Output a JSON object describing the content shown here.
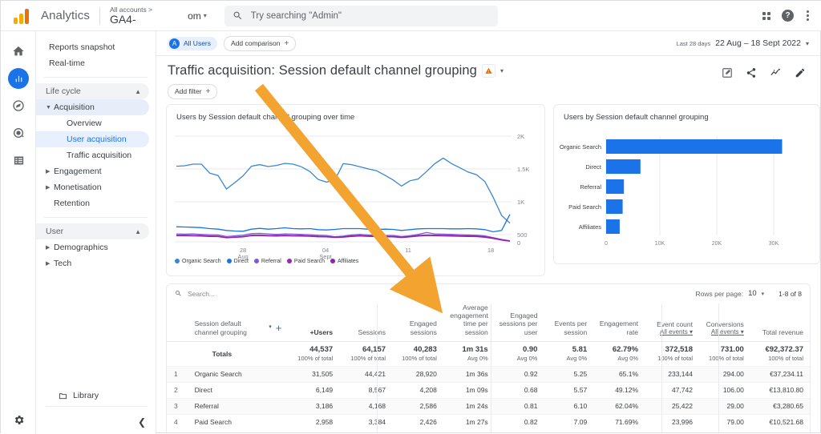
{
  "header": {
    "brand": "Analytics",
    "account_label": "All accounts >",
    "property_name": "GA4-",
    "property_tail": "om",
    "search_placeholder": "Try searching \"Admin\"",
    "logo_icon": "analytics-bars-icon",
    "apps_icon": "apps-grid-icon",
    "help_icon": "help-circle-icon",
    "more_icon": "kebab-more-icon"
  },
  "rail": {
    "items": [
      {
        "name": "home-icon",
        "label": "Home",
        "active": false
      },
      {
        "name": "reports-bar-chart-icon",
        "label": "Reports",
        "active": true
      },
      {
        "name": "explore-compass-icon",
        "label": "Explore",
        "active": false
      },
      {
        "name": "advertising-target-icon",
        "label": "Advertising",
        "active": false
      },
      {
        "name": "configure-list-icon",
        "label": "Configure",
        "active": false
      }
    ],
    "settings_icon": "gear-icon"
  },
  "sidebar": {
    "top_items": [
      {
        "label": "Reports snapshot"
      },
      {
        "label": "Real-time"
      }
    ],
    "groups": [
      {
        "label": "Life cycle",
        "chevron": "▲",
        "children": [
          {
            "label": "Acquisition",
            "type": "expandable",
            "expanded": true,
            "selected": true
          },
          {
            "label": "Overview",
            "type": "leaf",
            "active": false
          },
          {
            "label": "User acquisition",
            "type": "leaf",
            "active": true
          },
          {
            "label": "Traffic acquisition",
            "type": "leaf",
            "active": false
          },
          {
            "label": "Engagement",
            "type": "expandable",
            "expanded": false
          },
          {
            "label": "Monetisation",
            "type": "expandable",
            "expanded": false
          },
          {
            "label": "Retention",
            "type": "plain"
          }
        ]
      },
      {
        "label": "User",
        "chevron": "▲",
        "children": [
          {
            "label": "Demographics",
            "type": "expandable",
            "expanded": false
          },
          {
            "label": "Tech",
            "type": "expandable",
            "expanded": false
          }
        ]
      }
    ],
    "library_label": "Library",
    "library_icon": "folder-icon",
    "collapse_icon": "chevron-left-icon"
  },
  "toolbar": {
    "all_users_label": "All Users",
    "all_users_avatar": "A",
    "add_comparison_label": "Add comparison",
    "date_preset": "Last 28 days",
    "date_range": "22 Aug – 18 Sept 2022",
    "add_filter_label": "Add filter"
  },
  "page": {
    "title": "Traffic acquisition: Session default channel grouping",
    "warning_icon": "warning-triangle-icon",
    "title_caret": "▾",
    "actions": [
      {
        "name": "edit-comparison-icon",
        "label": "Edit"
      },
      {
        "name": "share-icon",
        "label": "Share this report"
      },
      {
        "name": "insights-icon",
        "label": "Insights"
      },
      {
        "name": "customise-pencil-icon",
        "label": "Customise report"
      }
    ]
  },
  "chart_data": [
    {
      "type": "line",
      "title": "Users by Session default channel grouping over time",
      "xlabel": "",
      "ylabel": "",
      "ylim": [
        0,
        2000
      ],
      "yticks": [
        "0",
        "500",
        "1K",
        "1.5K",
        "2K"
      ],
      "xticks": [
        {
          "line1": "28",
          "line2": "Aug"
        },
        {
          "line1": "04",
          "line2": "Sept"
        },
        {
          "line1": "11",
          "line2": ""
        },
        {
          "line1": "18",
          "line2": ""
        }
      ],
      "grid": true,
      "legend_position": "bottom",
      "series": [
        {
          "name": "Organic Search",
          "color": "#3b86d0",
          "values": [
            1430,
            1440,
            1470,
            1470,
            1300,
            1255,
            1000,
            1120,
            1250,
            1430,
            1460,
            1425,
            1445,
            1485,
            1470,
            1420,
            1330,
            1180,
            1130,
            1165,
            1480,
            1460,
            1420,
            1380,
            1345,
            1260,
            1170,
            1055,
            1155,
            1190,
            1330,
            1480,
            1585,
            1480,
            1400,
            1320,
            1270,
            1140,
            840,
            500,
            355
          ]
        },
        {
          "name": "Direct",
          "color": "#1a73e8",
          "values": [
            285,
            280,
            275,
            268,
            250,
            240,
            215,
            205,
            200,
            240,
            255,
            240,
            250,
            265,
            250,
            245,
            250,
            230,
            225,
            235,
            250,
            250,
            250,
            240,
            235,
            240,
            235,
            215,
            230,
            245,
            250,
            250,
            250,
            245,
            245,
            250,
            245,
            230,
            190,
            215,
            520
          ]
        },
        {
          "name": "Referral",
          "color": "#7b5bd6",
          "values": [
            150,
            145,
            148,
            140,
            135,
            130,
            100,
            110,
            125,
            155,
            160,
            150,
            140,
            150,
            145,
            140,
            135,
            125,
            120,
            95,
            108,
            130,
            140,
            130,
            125,
            120,
            118,
            100,
            115,
            140,
            175,
            150,
            145,
            140,
            135,
            130,
            125,
            110,
            80,
            45,
            20
          ]
        },
        {
          "name": "Paid Search",
          "color": "#9c27b0",
          "values": [
            125,
            125,
            120,
            118,
            112,
            108,
            82,
            90,
            100,
            125,
            130,
            120,
            118,
            124,
            120,
            118,
            113,
            105,
            100,
            88,
            95,
            112,
            120,
            112,
            108,
            105,
            100,
            88,
            100,
            118,
            130,
            126,
            122,
            118,
            115,
            112,
            108,
            95,
            70,
            38,
            15
          ]
        },
        {
          "name": "Affiliates",
          "color": "#8e24aa",
          "values": [
            115,
            115,
            112,
            108,
            102,
            98,
            76,
            84,
            92,
            115,
            120,
            112,
            108,
            114,
            110,
            108,
            104,
            96,
            92,
            82,
            88,
            102,
            110,
            103,
            99,
            96,
            92,
            80,
            92,
            108,
            120,
            116,
            112,
            108,
            105,
            102,
            98,
            86,
            62,
            32,
            12
          ]
        }
      ]
    },
    {
      "type": "bar",
      "orientation": "horizontal",
      "title": "Users by Session default channel grouping",
      "categories": [
        "Organic Search",
        "Direct",
        "Referral",
        "Paid Search",
        "Affiliates"
      ],
      "values": [
        31505,
        6149,
        3186,
        2958,
        2421
      ],
      "bar_color": "#1a73e8",
      "xlim": [
        0,
        34000
      ],
      "xticks": [
        "0",
        "10K",
        "20K",
        "30K"
      ],
      "grid": true
    }
  ],
  "table": {
    "search_placeholder": "Search...",
    "search_icon": "search-icon",
    "rows_per_page_label": "Rows per page:",
    "rows_per_page_value": "10",
    "rows_per_page_caret": "▾",
    "range_label": "1-8 of 8",
    "dimension_header": "Session default channel grouping",
    "dimension_caret": "▾",
    "add_dimension_icon": "plus-icon",
    "columns": [
      {
        "label": "+Users",
        "sorted": true,
        "sub": ""
      },
      {
        "label": "Sessions",
        "sorted": false,
        "sub": ""
      },
      {
        "label": "Engaged sessions",
        "sorted": false,
        "sub": ""
      },
      {
        "label": "Average engagement time per session",
        "sorted": false,
        "sub": ""
      },
      {
        "label": "Engaged sessions per user",
        "sorted": false,
        "sub": ""
      },
      {
        "label": "Events per session",
        "sorted": false,
        "sub": ""
      },
      {
        "label": "Engagement rate",
        "sorted": false,
        "sub": ""
      },
      {
        "label": "Event count",
        "sorted": false,
        "sub": "All events"
      },
      {
        "label": "Conversions",
        "sorted": false,
        "sub": "All events"
      },
      {
        "label": "Total revenue",
        "sorted": false,
        "sub": ""
      }
    ],
    "totals": {
      "label": "Totals",
      "values": [
        {
          "main": "44,537",
          "note": "100% of total"
        },
        {
          "main": "64,157",
          "note": "100% of total"
        },
        {
          "main": "40,283",
          "note": "100% of total"
        },
        {
          "main": "1m 31s",
          "note": "Avg 0%"
        },
        {
          "main": "0.90",
          "note": "Avg 0%"
        },
        {
          "main": "5.81",
          "note": "Avg 0%"
        },
        {
          "main": "62.79%",
          "note": "Avg 0%"
        },
        {
          "main": "372,518",
          "note": "100% of total"
        },
        {
          "main": "731.00",
          "note": "100% of total"
        },
        {
          "main": "€92,372.37",
          "note": "100% of total"
        }
      ]
    },
    "rows": [
      {
        "index": "1",
        "name": "Organic Search",
        "cells": [
          "31,505",
          "44,421",
          "28,920",
          "1m 36s",
          "0.92",
          "5.25",
          "65.1%",
          "233,144",
          "294.00",
          "€37,234.11"
        ]
      },
      {
        "index": "2",
        "name": "Direct",
        "cells": [
          "6,149",
          "8,567",
          "4,208",
          "1m 09s",
          "0.68",
          "5.57",
          "49.12%",
          "47,742",
          "106.00",
          "€13,810.80"
        ]
      },
      {
        "index": "3",
        "name": "Referral",
        "cells": [
          "3,186",
          "4,168",
          "2,586",
          "1m 24s",
          "0.81",
          "6.10",
          "62.04%",
          "25,422",
          "29.00",
          "€3,280.65"
        ]
      },
      {
        "index": "4",
        "name": "Paid Search",
        "cells": [
          "2,958",
          "3,384",
          "2,426",
          "1m 27s",
          "0.82",
          "7.09",
          "71.69%",
          "23,996",
          "79.00",
          "€10,521.68"
        ]
      }
    ]
  },
  "annotation": {
    "arrow_name": "orange-pointer-arrow",
    "color": "#f2a330"
  }
}
